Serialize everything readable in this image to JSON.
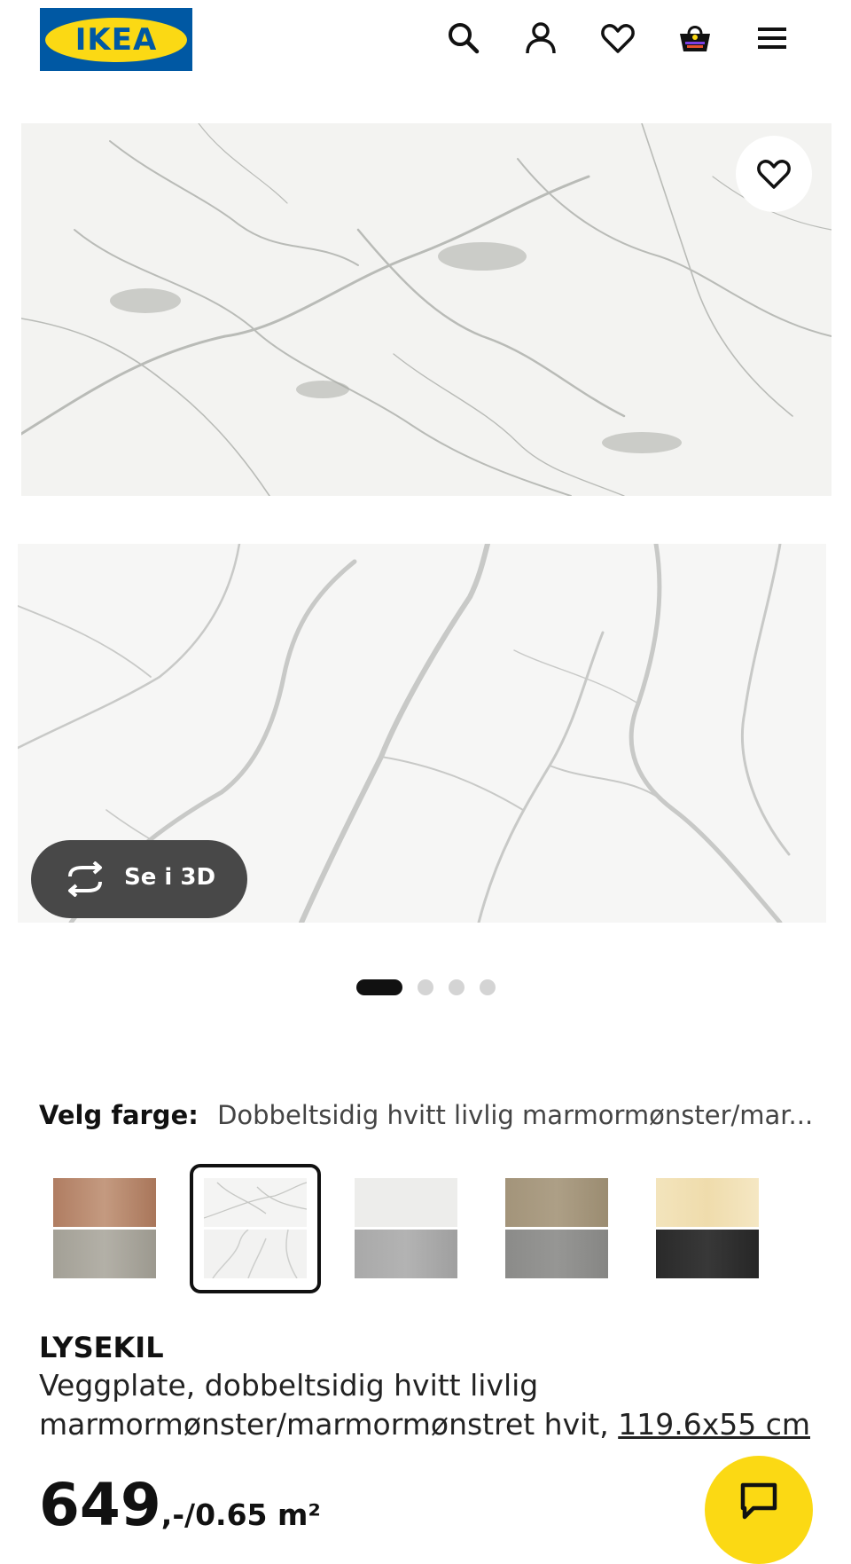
{
  "header": {
    "logo_text": "IKEA",
    "icons": [
      "search-icon",
      "account-icon",
      "favourites-icon",
      "cart-icon",
      "menu-icon"
    ]
  },
  "gallery": {
    "favourite_icon": "heart-icon",
    "view_3d_label": "Se i 3D",
    "dots_total": 4,
    "dot_active_index": 0
  },
  "color_selector": {
    "label": "Velg farge:",
    "selected_value": "Dobbeltsidig hvitt livlig marmormønster/mar...",
    "swatches": [
      {
        "top": "#b8876a",
        "bottom": "#a9a59b",
        "selected": false
      },
      {
        "top": "#f4f4f3",
        "bottom": "#f2f2f1",
        "selected": true
      },
      {
        "top": "#ededeb",
        "bottom": "#a6a6a6",
        "selected": false
      },
      {
        "top": "#a39478",
        "bottom": "#8d8d8b",
        "selected": false
      },
      {
        "top": "#f2e2b7",
        "bottom": "#2d2d2d",
        "selected": false
      }
    ]
  },
  "product": {
    "name": "LYSEKIL",
    "description": "Veggplate, dobbeltsidig hvitt livlig marmormønster/marmormønstret hvit, ",
    "size": "119.6x55 cm",
    "price_integer": "649",
    "price_suffix": ",-/0.65 m²"
  },
  "chat": {
    "icon": "chat-icon"
  },
  "colors": {
    "ikea_blue": "#0058a3",
    "ikea_yellow": "#fbd914",
    "dark_button": "#484848"
  }
}
